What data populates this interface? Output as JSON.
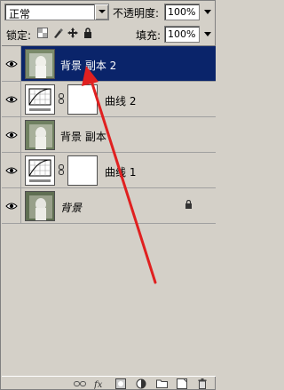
{
  "blend_mode": "正常",
  "opacity": {
    "label": "不透明度:",
    "value": "100%"
  },
  "lock": {
    "label": "锁定:"
  },
  "fill": {
    "label": "填充:",
    "value": "100%"
  },
  "layers": [
    {
      "name": "背景 副本 2",
      "type": "image",
      "selected": true,
      "visible": true
    },
    {
      "name": "曲线 2",
      "type": "curves",
      "selected": false,
      "visible": true
    },
    {
      "name": "背景 副本",
      "type": "image",
      "selected": false,
      "visible": true
    },
    {
      "name": "曲线 1",
      "type": "curves",
      "selected": false,
      "visible": true
    },
    {
      "name": "背景",
      "type": "image",
      "selected": false,
      "visible": true,
      "locked": true
    }
  ],
  "bottom_icons": [
    "link-icon",
    "fx-icon",
    "mask-icon",
    "adjustment-icon",
    "folder-icon",
    "new-layer-icon",
    "trash-icon"
  ],
  "colors": {
    "selected_row": "#0a246a",
    "panel_bg": "#d4d0c8",
    "annotation_arrow": "#e02020"
  }
}
